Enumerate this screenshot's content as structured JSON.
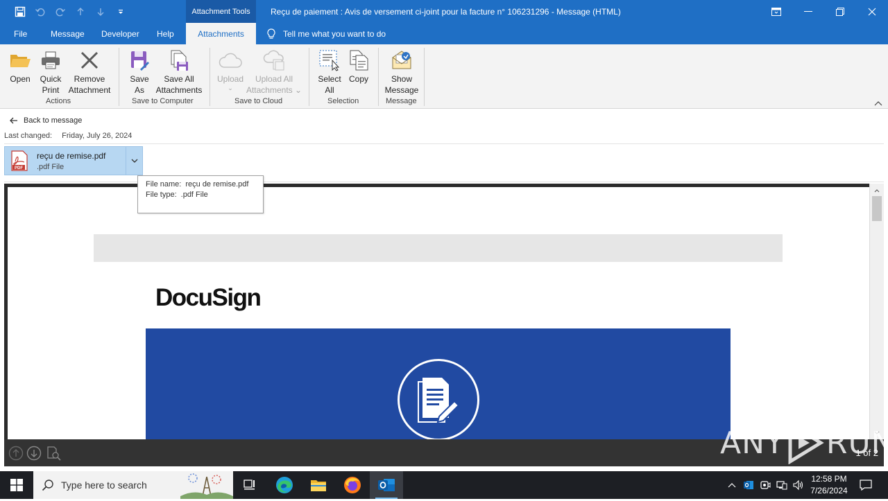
{
  "window": {
    "title": "Reçu de paiement : Avis de versement ci-joint pour la facture n° 106231296  -  Message (HTML)",
    "contextual_tab": "Attachment Tools"
  },
  "tabs": [
    {
      "label": "File"
    },
    {
      "label": "Message"
    },
    {
      "label": "Developer"
    },
    {
      "label": "Help"
    },
    {
      "label": "Attachments",
      "active": true
    }
  ],
  "tell_me": "Tell me what you want to do",
  "ribbon": {
    "actions": {
      "label": "Actions",
      "open": "Open",
      "quick_print": [
        "Quick",
        "Print"
      ],
      "remove_attachment": [
        "Remove",
        "Attachment"
      ]
    },
    "save_to_computer": {
      "label": "Save to Computer",
      "save_as": [
        "Save",
        "As"
      ],
      "save_all": [
        "Save All",
        "Attachments"
      ]
    },
    "save_to_cloud": {
      "label": "Save to Cloud",
      "upload": "Upload",
      "upload_all": [
        "Upload All",
        "Attachments"
      ]
    },
    "selection": {
      "label": "Selection",
      "select_all": [
        "Select",
        "All"
      ],
      "copy": "Copy"
    },
    "message": {
      "label": "Message",
      "show_message": [
        "Show",
        "Message"
      ]
    }
  },
  "attachment_view": {
    "back": "Back to message",
    "last_changed_label": "Last changed:",
    "last_changed_value": "Friday, July 26, 2024",
    "file_name": "reçu de remise.pdf",
    "file_type": ".pdf File",
    "pdf_icon_text": "PDF"
  },
  "tooltip": {
    "name_label": "File name:",
    "name_value": "reçu de remise.pdf",
    "type_label": "File type:",
    "type_value": ".pdf File"
  },
  "preview": {
    "logo": "DocuSign",
    "page_count": "1 of 2",
    "banner_color": "#214aa2"
  },
  "watermark": {
    "left": "ANY",
    "right": "RUN"
  },
  "taskbar": {
    "search_placeholder": "Type here to search",
    "time": "12:58 PM",
    "date": "7/26/2024",
    "apps": [
      "task-view",
      "edge",
      "file-explorer",
      "firefox",
      "outlook"
    ]
  },
  "colors": {
    "accent": "#1f6fc5",
    "attachment_chip": "#b7d7f2",
    "taskbar": "#1d1f24"
  }
}
